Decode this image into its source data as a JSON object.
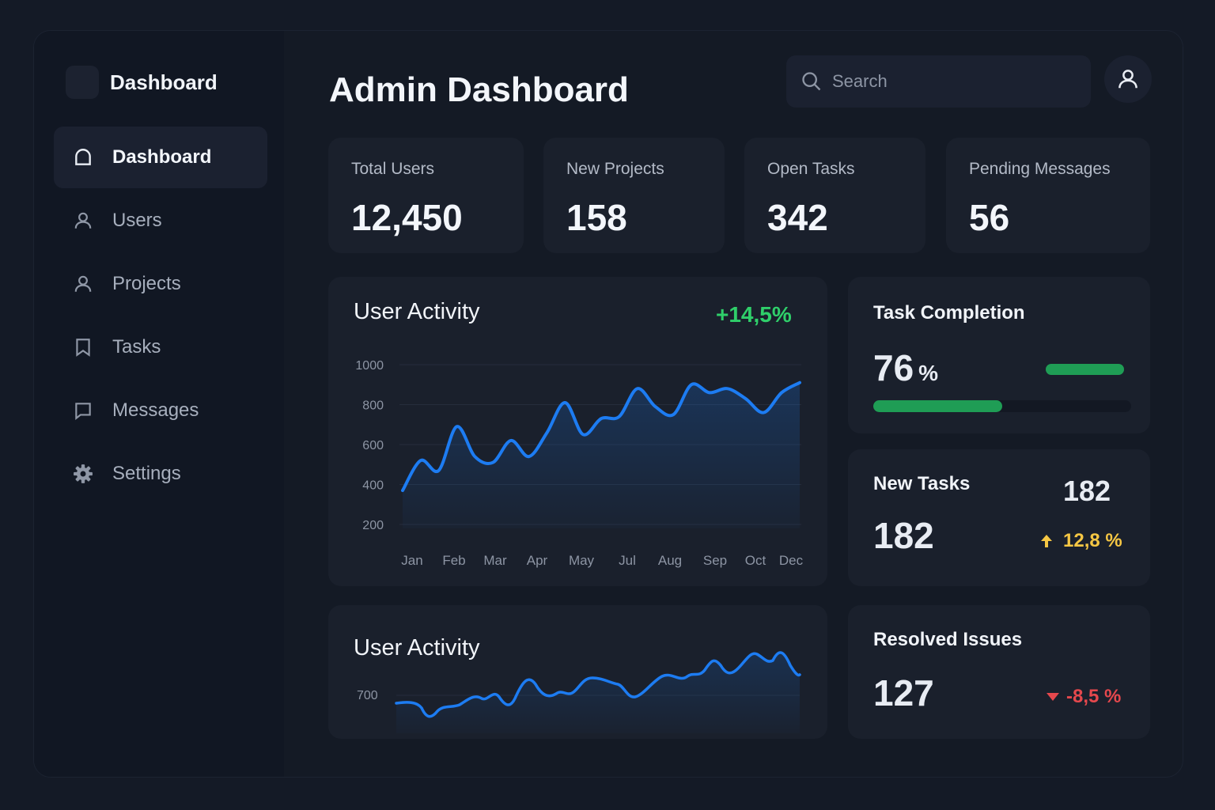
{
  "sidebar": {
    "brand": "Dashboard",
    "items": [
      {
        "label": "Dashboard",
        "icon": "home-icon"
      },
      {
        "label": "Users",
        "icon": "user-icon"
      },
      {
        "label": "Projects",
        "icon": "user-icon"
      },
      {
        "label": "Tasks",
        "icon": "bookmark-icon"
      },
      {
        "label": "Messages",
        "icon": "message-icon"
      },
      {
        "label": "Settings",
        "icon": "gear-icon"
      }
    ]
  },
  "header": {
    "title": "Admin Dashboard",
    "search_placeholder": "Search"
  },
  "stats": [
    {
      "label": "Total Users",
      "value": "12,450"
    },
    {
      "label": "New Projects",
      "value": "158"
    },
    {
      "label": "Open Tasks",
      "value": "342"
    },
    {
      "label": "Pending Messages",
      "value": "56"
    }
  ],
  "activity": {
    "title": "User Activity",
    "change": "+14,5%"
  },
  "task_completion": {
    "title": "Task Completion",
    "value": "76",
    "unit": "%",
    "progress": 0.5
  },
  "new_tasks": {
    "title": "New Tasks",
    "value": "182",
    "secondary": "182",
    "change": "12,8 %"
  },
  "activity_small": {
    "title": "User Activity",
    "tick": "700"
  },
  "resolved": {
    "title": "Resolved Issues",
    "value": "127",
    "change": "-8,5 %"
  },
  "colors": {
    "accent_blue": "#1d7cf2",
    "green": "#2fcf6a",
    "yellow": "#f6c744",
    "red": "#e5484d"
  },
  "chart_data": [
    {
      "type": "area",
      "x": [
        0,
        0.5,
        1,
        1.5,
        2,
        2.5,
        3,
        3.5,
        4,
        4.5,
        5,
        5.5,
        6,
        6.5,
        7,
        7.5,
        8,
        8.5,
        9,
        9.5,
        10,
        10.5,
        11
      ],
      "y": [
        370,
        520,
        470,
        690,
        540,
        510,
        620,
        540,
        660,
        810,
        650,
        730,
        740,
        880,
        790,
        750,
        900,
        860,
        880,
        830,
        760,
        860,
        910
      ],
      "tick_labels_x": [
        "Jan",
        "Feb",
        "Mar",
        "Apr",
        "May",
        "Jul",
        "Aug",
        "Sep",
        "Oct",
        "Dec"
      ],
      "tick_labels_y": [
        "1000",
        "800",
        "600",
        "400",
        "200"
      ],
      "ylim": [
        180,
        1000
      ],
      "grid": true
    }
  ]
}
